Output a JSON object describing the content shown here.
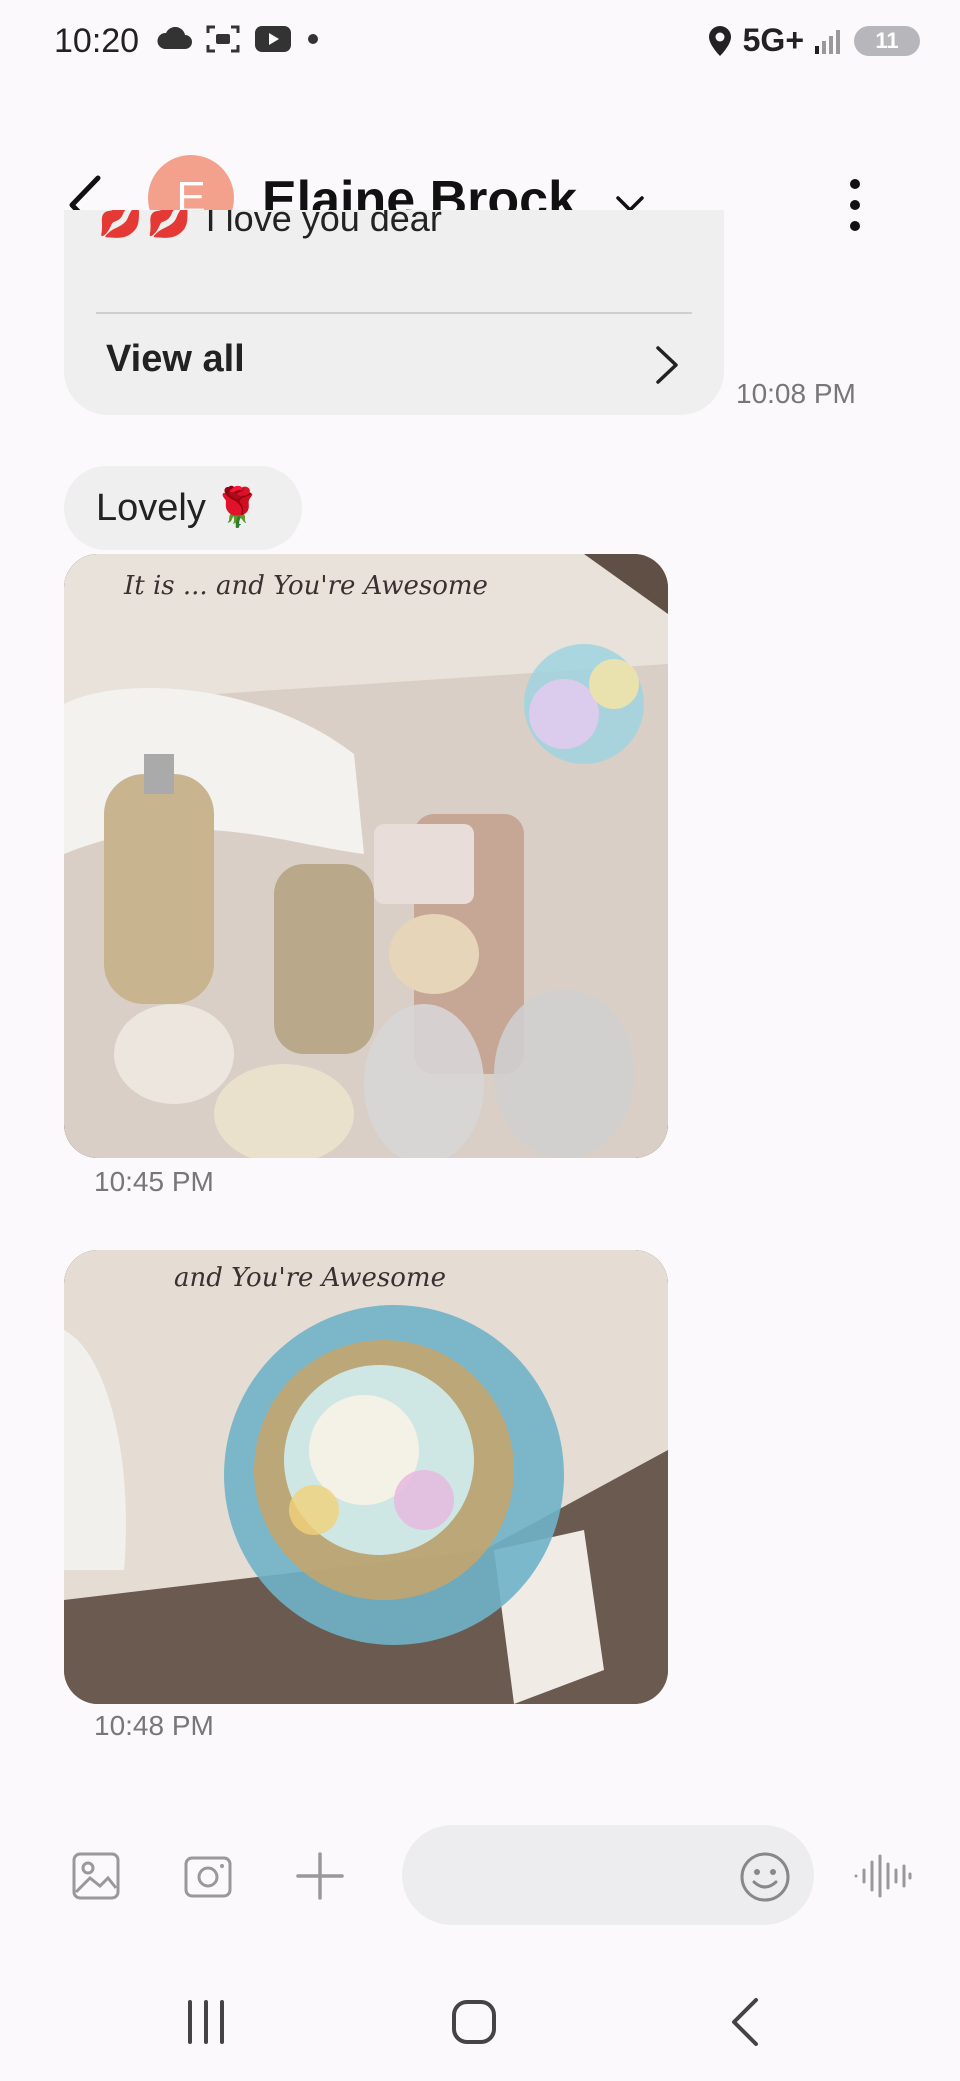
{
  "status_bar": {
    "time": "10:20",
    "network": "5G+",
    "battery": "11"
  },
  "header": {
    "avatar_initial": "E",
    "contact_name": "Elaine Brock"
  },
  "messages": {
    "card_partial_text": "I love you dear",
    "card_emojis": "💋💋",
    "view_all_label": "View all",
    "card_time": "10:08 PM",
    "lovely_text": "Lovely",
    "lovely_emoji": "🌹",
    "photo1_time": "10:45 PM",
    "photo2_time": "10:48 PM"
  },
  "composer": {
    "input_value": "",
    "input_placeholder": ""
  },
  "colors": {
    "background": "#fbf9fc",
    "bubble": "#efefef",
    "avatar": "#f3a18c",
    "timestamp": "#777777"
  },
  "icons": [
    "cloud-icon",
    "screen-capture-icon",
    "youtube-icon",
    "location-icon",
    "signal-icon",
    "battery-icon",
    "back-icon",
    "chevron-down-icon",
    "more-vert-icon",
    "chevron-right-icon",
    "gallery-icon",
    "camera-icon",
    "plus-icon",
    "emoji-icon",
    "voice-record-icon",
    "recents-nav-icon",
    "home-nav-icon",
    "back-nav-icon"
  ]
}
